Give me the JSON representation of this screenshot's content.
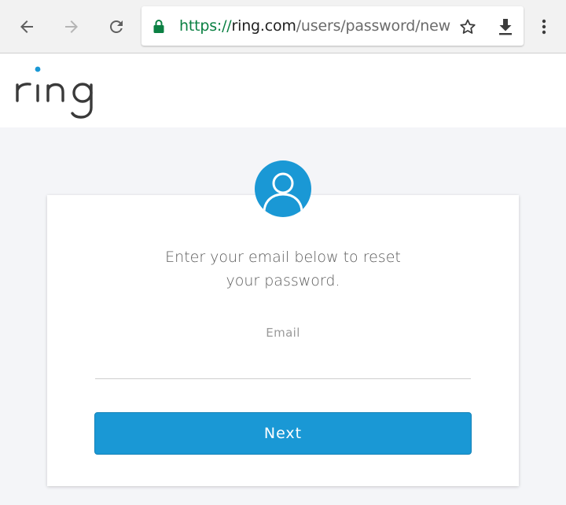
{
  "browser": {
    "url_scheme": "https://",
    "url_host": "ring.com",
    "url_path": "/users/password/new",
    "icons": [
      "back-arrow-icon",
      "forward-arrow-icon",
      "reload-icon",
      "lock-icon",
      "star-icon",
      "download-icon",
      "more-vert-icon"
    ]
  },
  "site": {
    "logo_text": "ring",
    "brand_color": "#1a98d5"
  },
  "reset": {
    "prompt_line1": "Enter your email below to reset",
    "prompt_line2": "your password.",
    "email_label": "Email",
    "email_value": "",
    "next_label": "Next"
  }
}
